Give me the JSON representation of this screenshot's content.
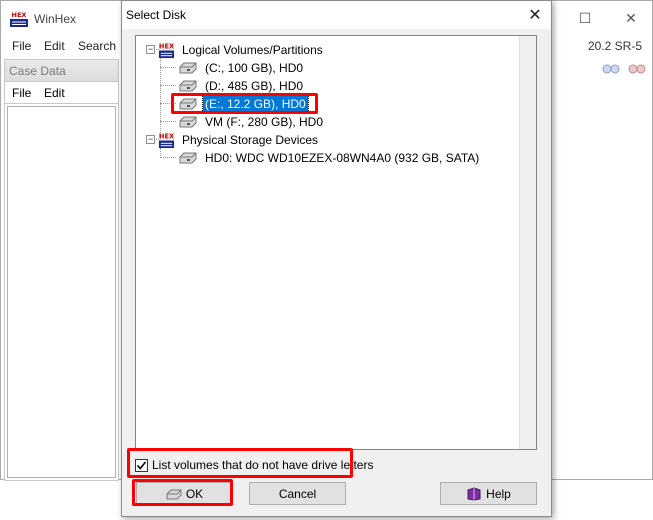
{
  "background_app": {
    "title": "WinHex",
    "menu": [
      "File",
      "Edit",
      "Search"
    ],
    "version": "20.2 SR-5",
    "case_panel": {
      "header": "Case Data",
      "menu": [
        "File",
        "Edit"
      ]
    }
  },
  "dialog": {
    "title": "Select Disk",
    "tree": {
      "groups": [
        {
          "label": "Logical Volumes/Partitions",
          "expanded": true,
          "items": [
            {
              "label": "(C:, 100 GB), HD0"
            },
            {
              "label": "(D:, 485 GB), HD0"
            },
            {
              "label": "(E:, 12.2 GB), HD0",
              "selected": true
            },
            {
              "label": "VM (F:, 280 GB), HD0"
            }
          ]
        },
        {
          "label": "Physical Storage Devices",
          "expanded": true,
          "items": [
            {
              "label": "HD0: WDC WD10EZEX-08WN4A0 (932 GB, SATA)"
            }
          ]
        }
      ]
    },
    "checkbox": {
      "label": "List volumes that do not have drive letters",
      "checked": true
    },
    "buttons": {
      "ok": "OK",
      "cancel": "Cancel",
      "help": "Help"
    }
  },
  "colors": {
    "selection": "#0078d7",
    "highlight": "#ff0000"
  }
}
